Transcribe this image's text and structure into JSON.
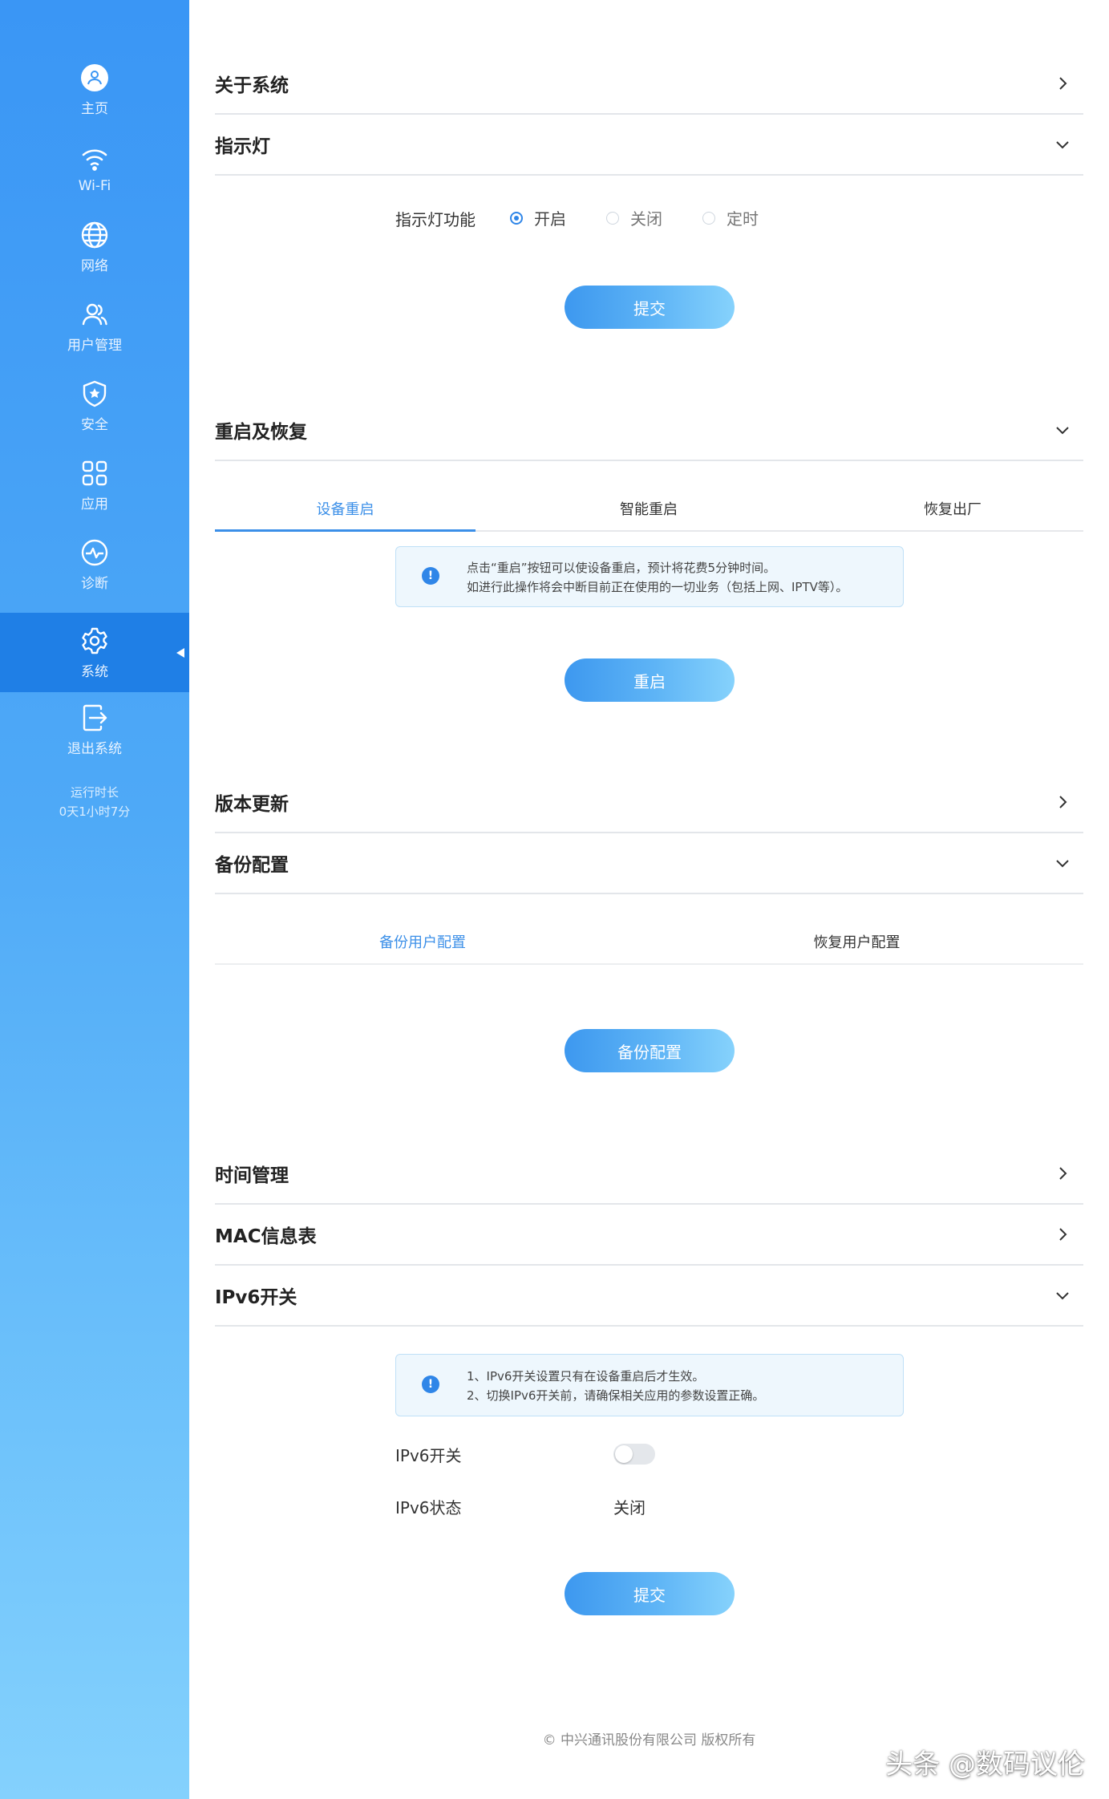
{
  "sidebar": {
    "items": [
      {
        "label": "主页",
        "icon": "home-avatar-icon"
      },
      {
        "label": "Wi-Fi",
        "icon": "wifi-icon"
      },
      {
        "label": "网络",
        "icon": "globe-icon"
      },
      {
        "label": "用户管理",
        "icon": "users-icon"
      },
      {
        "label": "安全",
        "icon": "shield-icon"
      },
      {
        "label": "应用",
        "icon": "apps-grid-icon"
      },
      {
        "label": "诊断",
        "icon": "diagnose-icon"
      },
      {
        "label": "系统",
        "icon": "gear-icon",
        "active": true
      },
      {
        "label": "退出系统",
        "icon": "logout-icon"
      }
    ],
    "uptime_label": "运行时长",
    "uptime_value": "0天1小时7分"
  },
  "sections": {
    "about": {
      "title": "关于系统"
    },
    "indicator": {
      "title": "指示灯",
      "field_label": "指示灯功能",
      "options": [
        "开启",
        "关闭",
        "定时"
      ],
      "selected": "开启",
      "submit": "提交"
    },
    "reboot": {
      "title": "重启及恢复",
      "tabs": [
        "设备重启",
        "智能重启",
        "恢复出厂"
      ],
      "active_tab": "设备重启",
      "notice_line1": "点击“重启”按钮可以使设备重启，预计将花费5分钟时间。",
      "notice_line2": "如进行此操作将会中断目前正在使用的一切业务（包括上网、IPTV等）。",
      "button": "重启"
    },
    "version": {
      "title": "版本更新"
    },
    "backup": {
      "title": "备份配置",
      "tabs": [
        "备份用户配置",
        "恢复用户配置"
      ],
      "active_tab": "备份用户配置",
      "button": "备份配置"
    },
    "time": {
      "title": "时间管理"
    },
    "mac": {
      "title": "MAC信息表"
    },
    "ipv6": {
      "title": "IPv6开关",
      "notice_line1": "1、IPv6开关设置只有在设备重启后才生效。",
      "notice_line2": "2、切换IPv6开关前，请确保相关应用的参数设置正确。",
      "switch_label": "IPv6开关",
      "switch_on": false,
      "status_label": "IPv6状态",
      "status_value": "关闭",
      "submit": "提交"
    }
  },
  "footer": "© 中兴通讯股份有限公司 版权所有",
  "watermark": "头条 @数码议伦",
  "colors": {
    "accent": "#2f86e8",
    "sidebar_top": "#3a96f5",
    "sidebar_bottom": "#84d1fd"
  }
}
